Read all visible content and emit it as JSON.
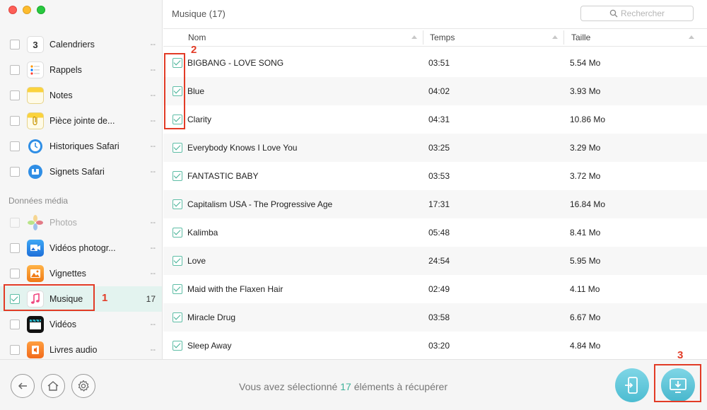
{
  "window": {
    "title_label": "Musique",
    "title_count": "(17)"
  },
  "sidebar": {
    "items_top": [
      {
        "label": "Calendriers",
        "count": "--",
        "icon": "calendar-icon",
        "icon_text": "3"
      },
      {
        "label": "Rappels",
        "count": "--",
        "icon": "reminders-icon"
      },
      {
        "label": "Notes",
        "count": "--",
        "icon": "notes-icon"
      },
      {
        "label": "Pièce jointe de...",
        "count": "--",
        "icon": "attachment-icon"
      },
      {
        "label": "Historiques Safari",
        "count": "--",
        "icon": "safari-history-icon"
      },
      {
        "label": "Signets Safari",
        "count": "--",
        "icon": "safari-bookmarks-icon"
      }
    ],
    "media_header": "Données média",
    "items_media": [
      {
        "label": "Photos",
        "count": "--",
        "icon": "photos-icon"
      },
      {
        "label": "Vidéos photogr...",
        "count": "--",
        "icon": "photo-videos-icon"
      },
      {
        "label": "Vignettes",
        "count": "--",
        "icon": "thumbnails-icon"
      },
      {
        "label": "Musique",
        "count": "17",
        "icon": "music-icon"
      },
      {
        "label": "Vidéos",
        "count": "--",
        "icon": "videos-icon"
      },
      {
        "label": "Livres audio",
        "count": "--",
        "icon": "audiobooks-icon"
      }
    ]
  },
  "search": {
    "placeholder": "Rechercher"
  },
  "table": {
    "columns": [
      "Nom",
      "Temps",
      "Taille"
    ],
    "rows": [
      {
        "name": "BIGBANG - LOVE SONG",
        "time": "03:51",
        "size": "5.54 Mo"
      },
      {
        "name": "Blue",
        "time": "04:02",
        "size": "3.93 Mo"
      },
      {
        "name": "Clarity",
        "time": "04:31",
        "size": "10.86 Mo"
      },
      {
        "name": "Everybody Knows I Love You",
        "time": "03:25",
        "size": "3.29 Mo"
      },
      {
        "name": "FANTASTIC BABY",
        "time": "03:53",
        "size": "3.72 Mo"
      },
      {
        "name": "Capitalism USA - The Progressive Age",
        "time": "17:31",
        "size": "16.84 Mo"
      },
      {
        "name": "Kalimba",
        "time": "05:48",
        "size": "8.41 Mo"
      },
      {
        "name": "Love",
        "time": "24:54",
        "size": "5.95 Mo"
      },
      {
        "name": "Maid with the Flaxen Hair",
        "time": "02:49",
        "size": "4.11 Mo"
      },
      {
        "name": "Miracle Drug",
        "time": "03:58",
        "size": "6.67 Mo"
      },
      {
        "name": "Sleep Away",
        "time": "03:20",
        "size": "4.84 Mo"
      }
    ]
  },
  "footer": {
    "status_before": "Vous avez sélectionné",
    "status_count": "17",
    "status_after": "éléments à récupérer"
  },
  "annotations": [
    "1",
    "2",
    "3"
  ],
  "colors": {
    "accent": "#3eb29a",
    "annotation": "#e23b26",
    "button": "#4cbcd1"
  }
}
